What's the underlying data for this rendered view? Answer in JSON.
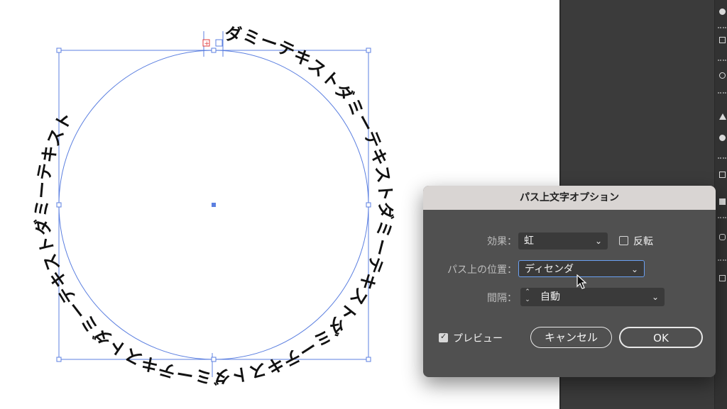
{
  "artboard": {
    "path_text": "ダミーテキストダミーテキストダミーテキストダミーテキストダミーテキストダミーテキストダミーテキスト"
  },
  "dialog": {
    "title": "パス上文字オプション",
    "effect_label": "効果：",
    "effect_value": "虹",
    "flip_label": "反転",
    "flip_checked": false,
    "align_label": "パス上の位置：",
    "align_value": "ディセンダ",
    "spacing_label": "間隔：",
    "spacing_value": "自動",
    "preview_label": "プレビュー",
    "preview_checked": true,
    "cancel_label": "キャンセル",
    "ok_label": "OK"
  },
  "colors": {
    "selection": "#5b7fe0",
    "panel_bg": "#3b3b3b",
    "dialog_bg": "#505050",
    "titlebar_bg": "#d9d5d3",
    "focus_ring": "#6aa0f2"
  }
}
